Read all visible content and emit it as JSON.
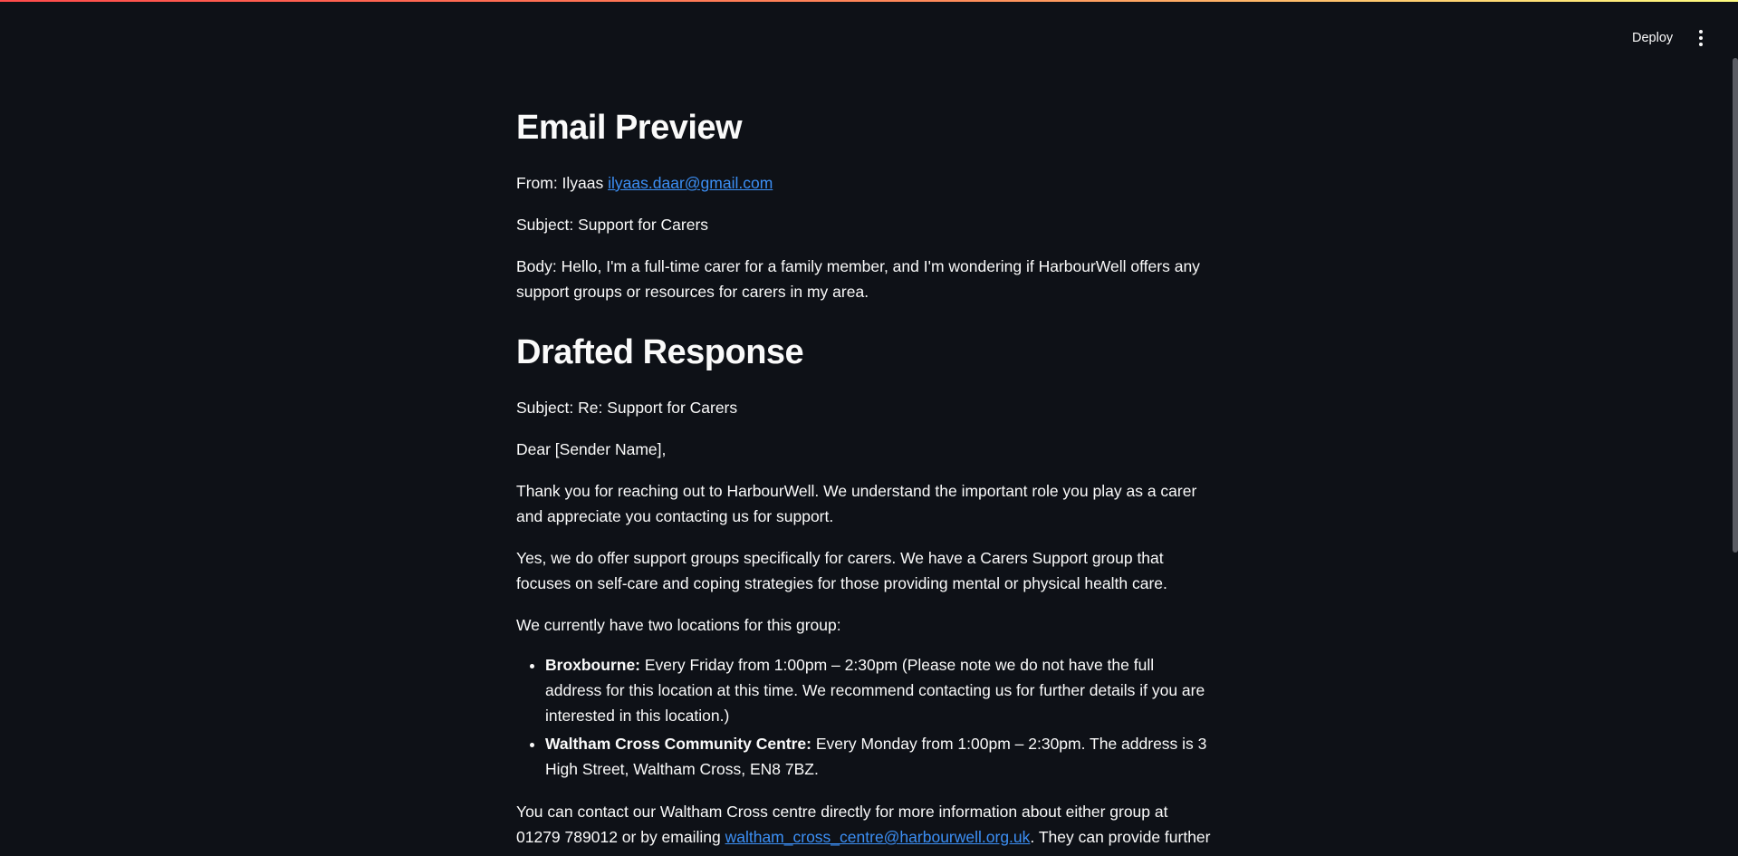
{
  "header": {
    "deploy_label": "Deploy",
    "menu_icon": "more-vertical-icon"
  },
  "email_preview": {
    "title": "Email Preview",
    "from_prefix": "From: Ilyaas ",
    "from_email": "ilyaas.daar@gmail.com",
    "subject": "Subject: Support for Carers",
    "body": "Body: Hello, I'm a full-time carer for a family member, and I'm wondering if HarbourWell offers any support groups or resources for carers in my area."
  },
  "drafted_response": {
    "title": "Drafted Response",
    "subject": "Subject: Re: Support for Carers",
    "greeting": "Dear [Sender Name],",
    "para1": "Thank you for reaching out to HarbourWell. We understand the important role you play as a carer and appreciate you contacting us for support.",
    "para2": "Yes, we do offer support groups specifically for carers. We have a Carers Support group that focuses on self-care and coping strategies for those providing mental or physical health care.",
    "para3": "We currently have two locations for this group:",
    "locations": [
      {
        "name": "Broxbourne:",
        "details": " Every Friday from 1:00pm – 2:30pm (Please note we do not have the full address for this location at this time. We recommend contacting us for further details if you are interested in this location.)"
      },
      {
        "name": "Waltham Cross Community Centre:",
        "details": " Every Monday from 1:00pm – 2:30pm. The address is 3 High Street, Waltham Cross, EN8 7BZ."
      }
    ],
    "contact_prefix": "You can contact our Waltham Cross centre directly for more information about either group at 01279 789012 or by emailing ",
    "contact_email": "waltham_cross_centre@harbourwell.org.uk",
    "contact_suffix": ". They can provide further details"
  }
}
